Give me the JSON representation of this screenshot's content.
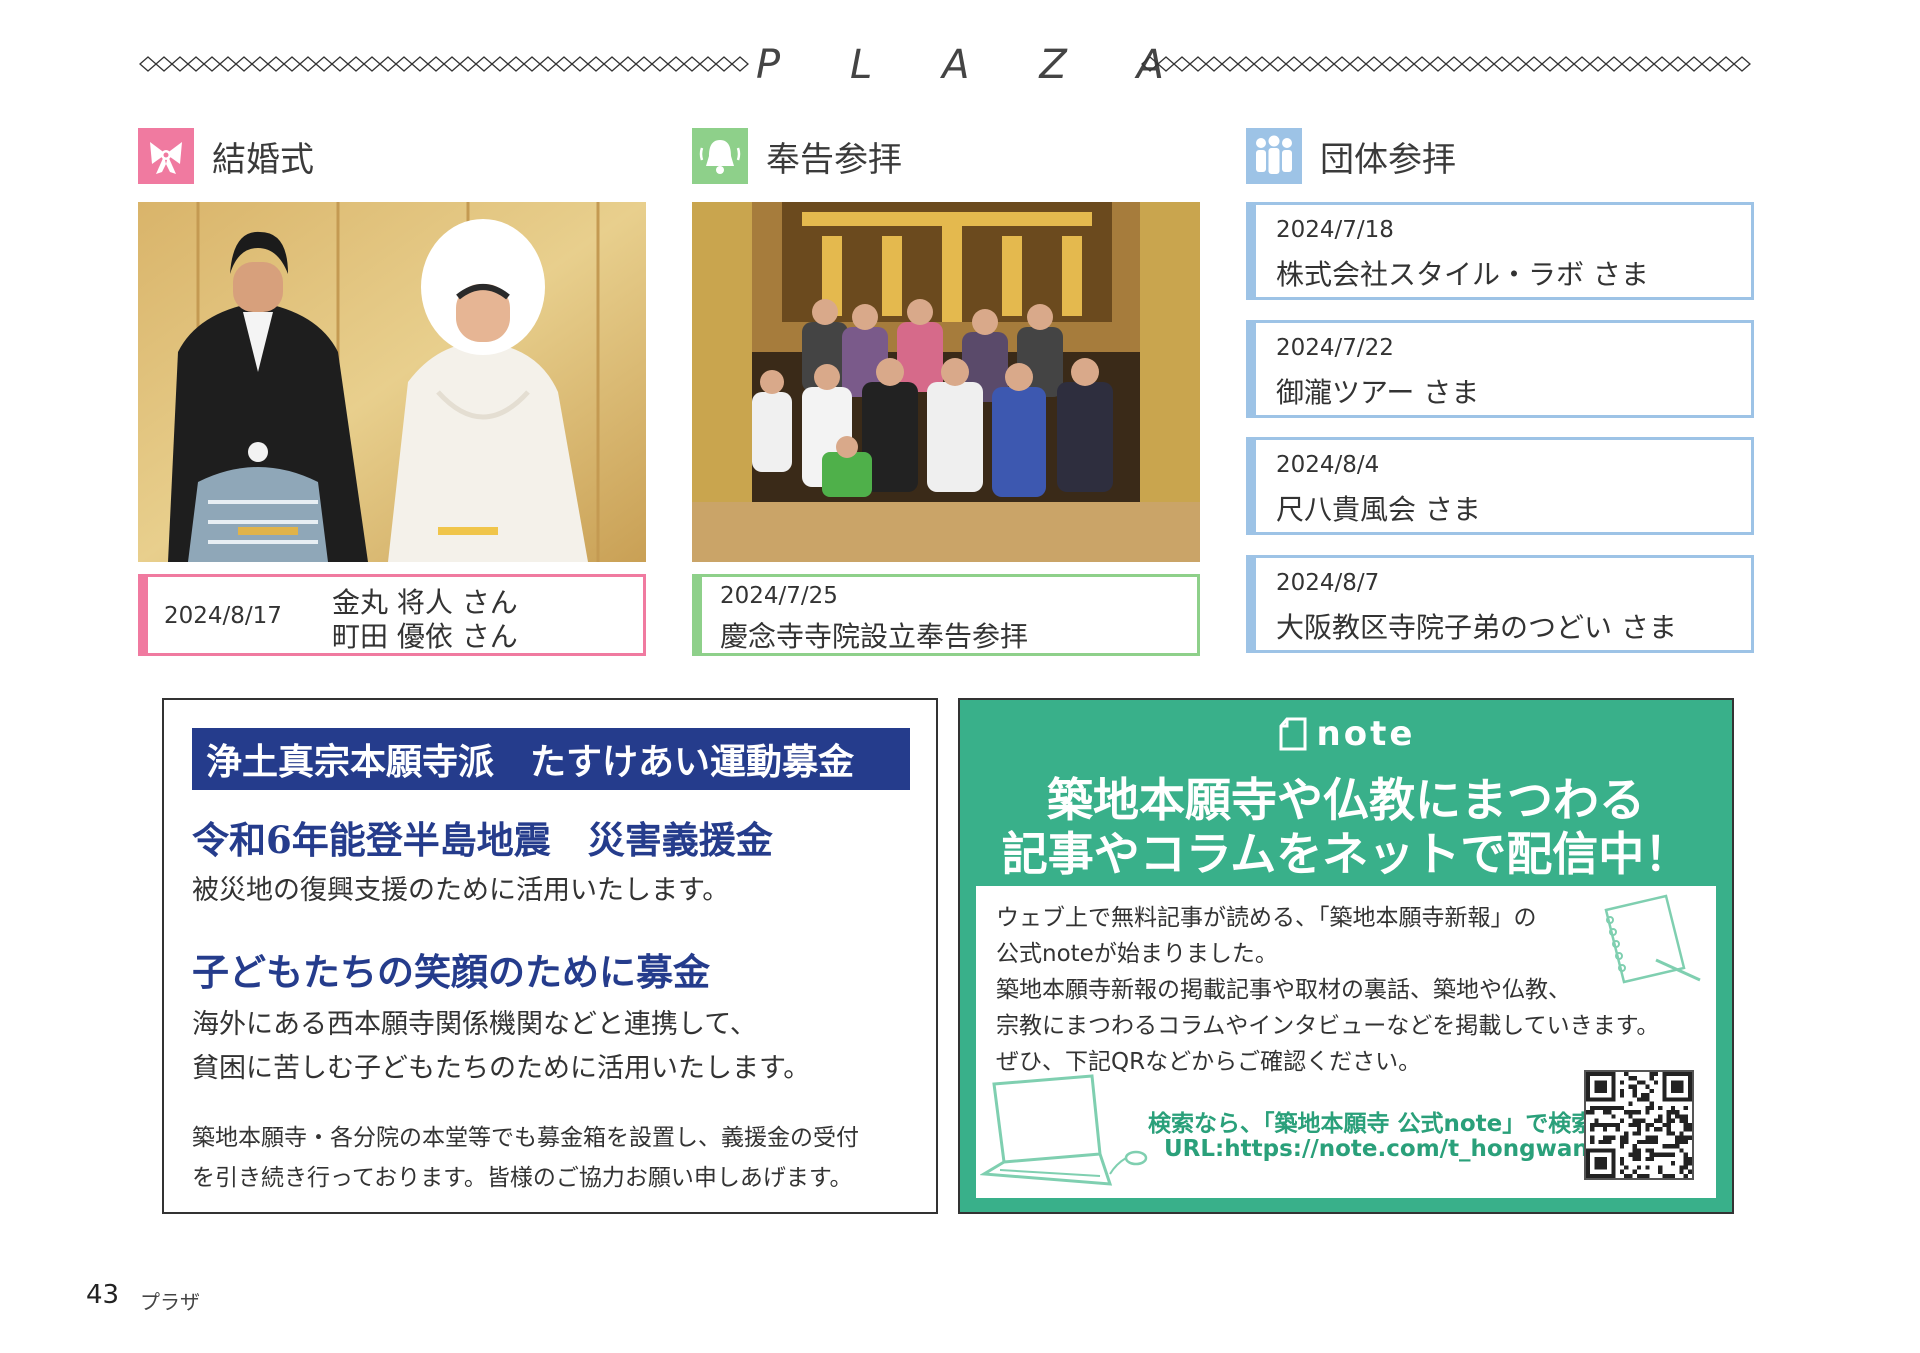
{
  "header": {
    "letters": [
      "P",
      "L",
      "A",
      "Z",
      "A"
    ]
  },
  "sections": {
    "wedding": {
      "title": "結婚式"
    },
    "report": {
      "title": "奉告参拝"
    },
    "group": {
      "title": "団体参拝"
    }
  },
  "wedding_caption": {
    "date": "2024/8/17",
    "name1": "金丸 将人 さん",
    "name2": "町田 優依 さん"
  },
  "report_caption": {
    "date": "2024/7/25",
    "name": "慶念寺寺院設立奉告参拝"
  },
  "group_visits": [
    {
      "date": "2024/7/18",
      "name": "株式会社スタイル・ラボ さま"
    },
    {
      "date": "2024/7/22",
      "name": "御瀧ツアー さま"
    },
    {
      "date": "2024/8/4",
      "name": "尺八貴風会 さま"
    },
    {
      "date": "2024/8/7",
      "name": "大阪教区寺院子弟のつどい さま"
    }
  ],
  "donation": {
    "banner": "浄土真宗本願寺派　たすけあい運動募金",
    "h1": "令和6年能登半島地震　災害義援金",
    "p1": "被災地の復興支援のために活用いたします。",
    "h2": "子どもたちの笑顔のために募金",
    "p2a": "海外にある西本願寺関係機関などと連携して、",
    "p2b": "貧困に苦しむ子どもたちのために活用いたします。",
    "s1": "築地本願寺・各分院の本堂等でも募金箱を設置し、義援金の受付",
    "s2": "を引き続き行っております。皆様のご協力お願い申しあげます。"
  },
  "note": {
    "logo": "note",
    "head1": "築地本願寺や仏教にまつわる",
    "head2": "記事やコラムをネットで配信中！",
    "lines": [
      "ウェブ上で無料記事が読める、「築地本願寺新報」の",
      "公式noteが始まりました。",
      "築地本願寺新報の掲載記事や取材の裏話、築地や仏教、",
      "宗教にまつわるコラムやインタビューなどを掲載していきます。",
      "ぜひ、下記QRなどからご確認ください。"
    ],
    "search": "検索なら、「築地本願寺 公式note」で検索！",
    "url": "URL:https://note.com/t_hongwanji"
  },
  "footer": {
    "page": "43",
    "label": "プラザ"
  },
  "colors": {
    "pink": "#f07aa0",
    "green": "#8ed08a",
    "blue": "#9dc3e6",
    "navy": "#253c8c",
    "teal": "#39b08a"
  }
}
